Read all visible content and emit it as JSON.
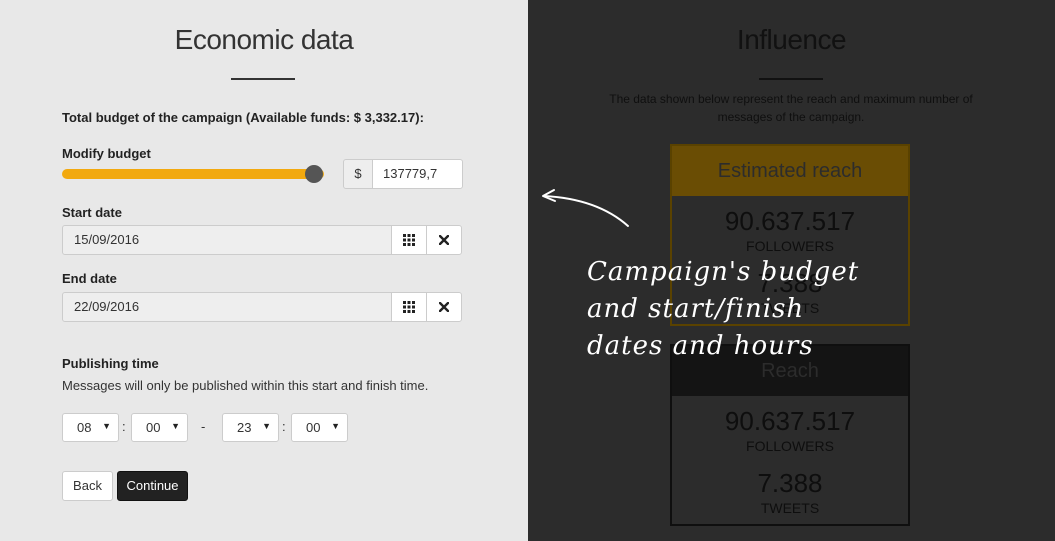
{
  "left_panel": {
    "title": "Economic data",
    "budget_label": "Total budget of the campaign (Available funds: $ 3,332.17):",
    "modify_label": "Modify budget",
    "slider_fraction": 0.96,
    "currency": "$",
    "budget_value": "137779,7",
    "start_label": "Start date",
    "start_value": "15/09/2016",
    "end_label": "End date",
    "end_value": "22/09/2016",
    "publishing_label": "Publishing time",
    "publishing_help": "Messages will only be published within this start and finish time.",
    "time": {
      "start_hour": "08",
      "start_min": "00",
      "end_hour": "23",
      "end_min": "00",
      "colon": ":",
      "dash": "-"
    },
    "back_label": "Back",
    "continue_label": "Continue",
    "accent": "#f2a90f"
  },
  "right_panel": {
    "title": "Influence",
    "description": "The data shown below represent the reach and maximum number of messages of the campaign.",
    "card1": {
      "header": "Estimated reach",
      "followers": "90.637.517",
      "followers_label": "FOLLOWERS",
      "tweets": "7.388",
      "tweets_label": "TWEETS"
    },
    "card2": {
      "header": "Reach",
      "followers": "90.637.517",
      "followers_label": "FOLLOWERS",
      "tweets": "7.388",
      "tweets_label": "TWEETS"
    }
  },
  "annotation": {
    "line1": "Campaign's budget",
    "line2": "and start/finish",
    "line3": "dates and hours"
  },
  "icons": [
    "calendar-grid-icon",
    "clear-x-icon",
    "caret-down-icon",
    "arrow-icon"
  ]
}
